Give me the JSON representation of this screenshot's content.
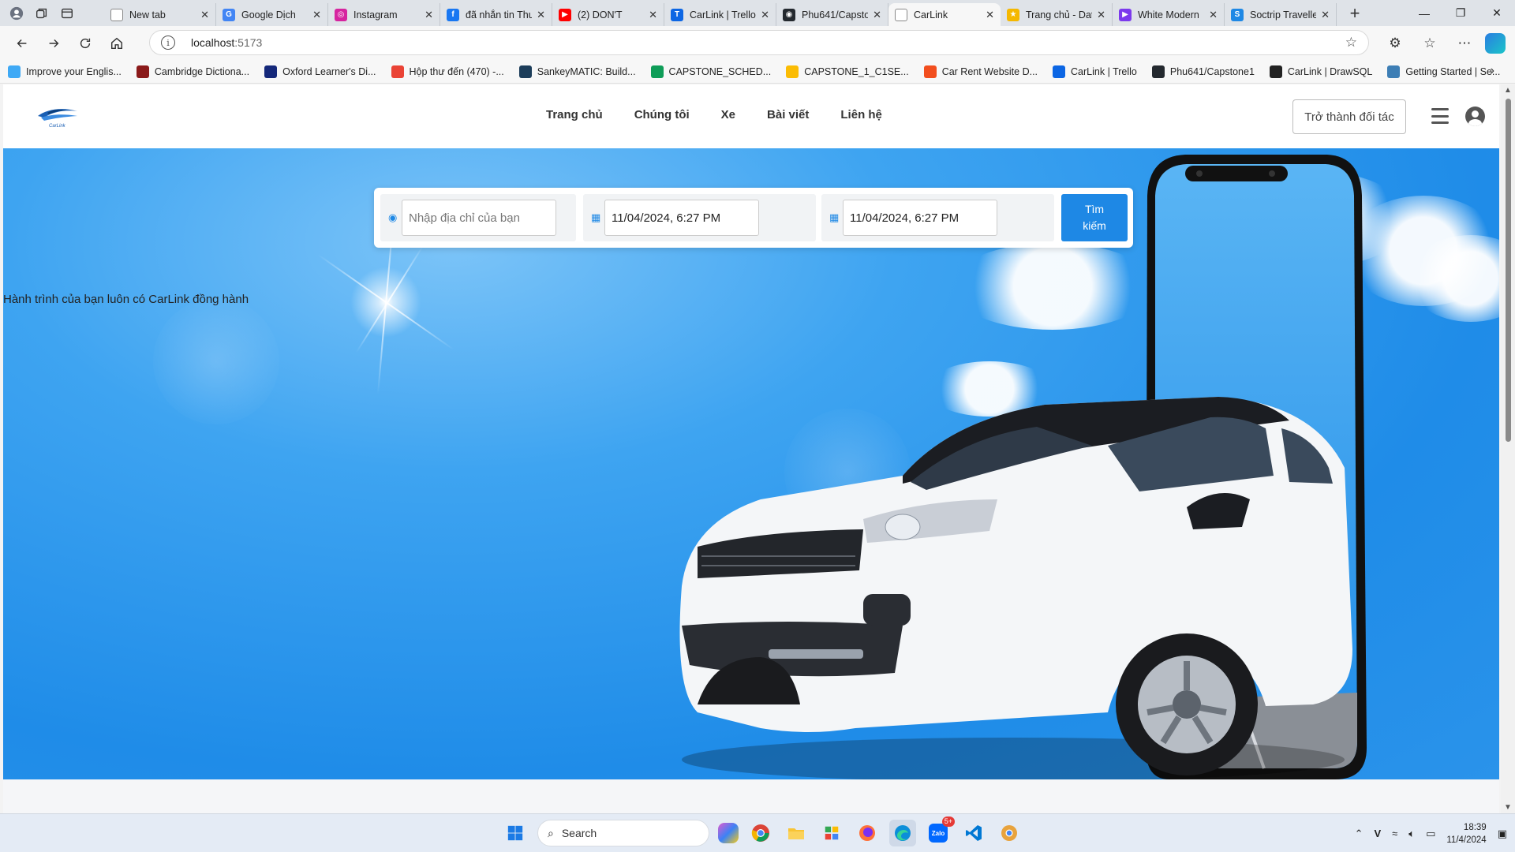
{
  "browser": {
    "tabs": [
      {
        "title": "New tab",
        "color": "#ffffff",
        "glyph": ""
      },
      {
        "title": "Google Dịch",
        "color": "#4285f4",
        "glyph": "G"
      },
      {
        "title": "Instagram",
        "color": "#d6249f",
        "glyph": "◎"
      },
      {
        "title": "đã nhắn tin Thu",
        "color": "#1877f2",
        "glyph": "f"
      },
      {
        "title": "(2) DON'T",
        "color": "#ff0000",
        "glyph": "▶"
      },
      {
        "title": "CarLink | Trello",
        "color": "#0c66e4",
        "glyph": "T"
      },
      {
        "title": "Phu641/Capsto",
        "color": "#24292f",
        "glyph": "◉"
      },
      {
        "title": "CarLink",
        "color": "#ffffff",
        "glyph": ""
      },
      {
        "title": "Trang chủ - Dat",
        "color": "#f5b800",
        "glyph": "★"
      },
      {
        "title": "White Modern",
        "color": "#7c3aed",
        "glyph": "▶"
      },
      {
        "title": "Soctrip Travelle",
        "color": "#1e88e5",
        "glyph": "S"
      }
    ],
    "active_tab_index": 7,
    "url_host": "localhost",
    "url_port": ":5173",
    "bookmarks": [
      {
        "label": "Improve your Englis...",
        "color": "#3fa9f5"
      },
      {
        "label": "Cambridge Dictiona...",
        "color": "#8b1a1a"
      },
      {
        "label": "Oxford Learner's Di...",
        "color": "#14287a"
      },
      {
        "label": "Hộp thư đến (470) -...",
        "color": "#ea4335"
      },
      {
        "label": "SankeyMATIC: Build...",
        "color": "#1c3d5a"
      },
      {
        "label": "CAPSTONE_SCHED...",
        "color": "#0f9d58"
      },
      {
        "label": "CAPSTONE_1_C1SE...",
        "color": "#fbbc04"
      },
      {
        "label": "Car Rent Website D...",
        "color": "#f24e1e"
      },
      {
        "label": "CarLink | Trello",
        "color": "#0c66e4"
      },
      {
        "label": "Phu641/Capstone1",
        "color": "#24292f"
      },
      {
        "label": "CarLink | DrawSQL",
        "color": "#222222"
      },
      {
        "label": "Getting Started | Se...",
        "color": "#3d7eb5"
      }
    ]
  },
  "site": {
    "logo_text": "CarLink",
    "nav": [
      "Trang chủ",
      "Chúng tôi",
      "Xe",
      "Bài viết",
      "Liên hệ"
    ],
    "partner_button": "Trở thành đối tác",
    "search": {
      "address_placeholder": "Nhập địa chỉ của bạn",
      "start_datetime": "11/04/2024, 6:27 PM",
      "end_datetime": "11/04/2024, 6:27 PM",
      "button_line1": "Tìm",
      "button_line2": "kiếm"
    },
    "tagline": "Hành trình của bạn luôn có CarLink đồng hành",
    "accent_color": "#1e88e5"
  },
  "taskbar": {
    "search_placeholder": "Search",
    "zalo_badge": "5+",
    "time": "18:39",
    "date": "11/4/2024"
  }
}
